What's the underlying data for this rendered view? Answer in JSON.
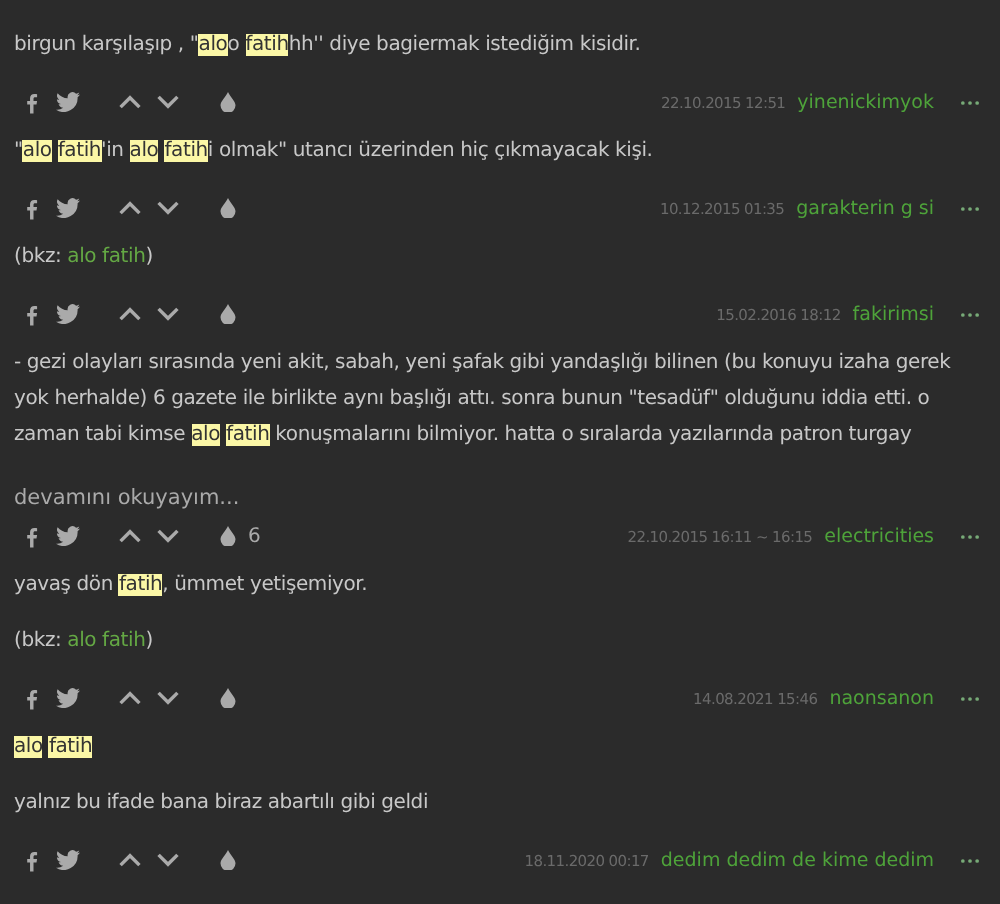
{
  "entries": [
    {
      "paragraphs": [
        [
          {
            "kind": "text",
            "text": "birgun karşılaşıp , \""
          },
          {
            "kind": "mark",
            "text": "alo"
          },
          {
            "kind": "text",
            "text": "o "
          },
          {
            "kind": "mark",
            "text": "fatih"
          },
          {
            "kind": "text",
            "text": "hh'' diye bagiermak istediğim kisidir."
          }
        ]
      ],
      "date": "22.10.2015 12:51",
      "author": "yinenickimyok"
    },
    {
      "paragraphs": [
        [
          {
            "kind": "text",
            "text": "\""
          },
          {
            "kind": "mark",
            "text": "alo"
          },
          {
            "kind": "gap"
          },
          {
            "kind": "mark",
            "text": "fatih"
          },
          {
            "kind": "text",
            "text": "'in "
          },
          {
            "kind": "mark",
            "text": "alo"
          },
          {
            "kind": "gap"
          },
          {
            "kind": "mark",
            "text": "fatih"
          },
          {
            "kind": "text",
            "text": "i olmak\" utancı üzerinden hiç çıkmayacak kişi."
          }
        ]
      ],
      "date": "10.12.2015 01:35",
      "author": "garakterin g si"
    },
    {
      "paragraphs": [
        [
          {
            "kind": "text",
            "text": "(bkz: "
          },
          {
            "kind": "link",
            "text": "alo fatih"
          },
          {
            "kind": "text",
            "text": ")"
          }
        ]
      ],
      "date": "15.02.2016 18:12",
      "author": "fakirimsi"
    },
    {
      "paragraphs": [
        [
          {
            "kind": "text",
            "text": "- gezi olayları sırasında yeni akit, sabah, yeni şafak gibi yandaşlığı bilinen (bu konuyu izaha gerek yok herhalde) 6 gazete ile birlikte aynı başlığı attı. sonra bunun \"tesadüf\" olduğunu iddia etti. o zaman tabi kimse "
          },
          {
            "kind": "mark",
            "text": "alo"
          },
          {
            "kind": "gap"
          },
          {
            "kind": "mark",
            "text": "fatih"
          },
          {
            "kind": "text",
            "text": " konuşmalarını bilmiyor. hatta o sıralarda yazılarında patron turgay"
          }
        ]
      ],
      "more": "devamını okuyayım...",
      "favorites": "6",
      "date": "22.10.2015 16:11 ~ 16:15",
      "author": "electricities"
    },
    {
      "paragraphs": [
        [
          {
            "kind": "text",
            "text": "yavaş dön "
          },
          {
            "kind": "mark",
            "text": "fatih"
          },
          {
            "kind": "text",
            "text": ", ümmet yetişemiyor."
          }
        ],
        [
          {
            "kind": "text",
            "text": "(bkz: "
          },
          {
            "kind": "link",
            "text": "alo fatih"
          },
          {
            "kind": "text",
            "text": ")"
          }
        ]
      ],
      "date": "14.08.2021 15:46",
      "author": "naonsanon"
    },
    {
      "paragraphs": [
        [
          {
            "kind": "mark",
            "text": "alo"
          },
          {
            "kind": "gap"
          },
          {
            "kind": "mark",
            "text": "fatih"
          }
        ],
        [
          {
            "kind": "text",
            "text": "yalnız bu ifade bana biraz abartılı gibi geldi"
          }
        ]
      ],
      "date": "18.11.2020 00:17",
      "author": "dedim dedim de kime dedim"
    }
  ]
}
